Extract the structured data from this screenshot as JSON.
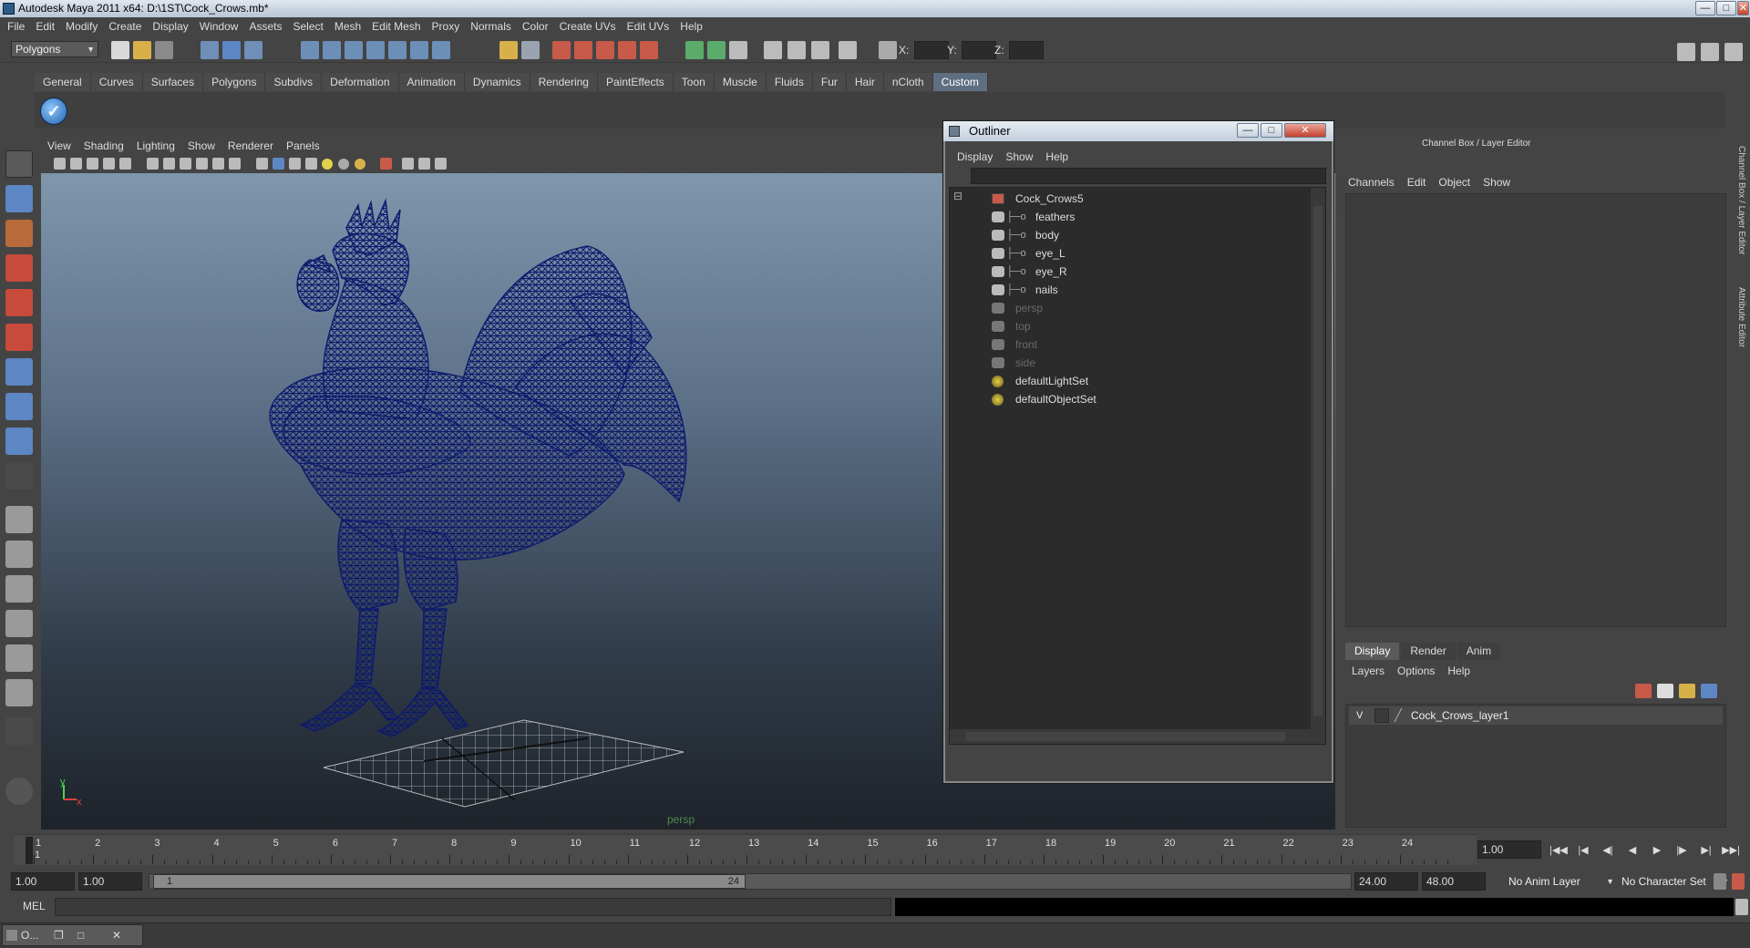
{
  "window": {
    "title": "Autodesk Maya 2011 x64: D:\\1ST\\Cock_Crows.mb*",
    "controls": [
      "—",
      "□",
      "✕"
    ]
  },
  "menubar": [
    "File",
    "Edit",
    "Modify",
    "Create",
    "Display",
    "Window",
    "Assets",
    "Select",
    "Mesh",
    "Edit Mesh",
    "Proxy",
    "Normals",
    "Color",
    "Create UVs",
    "Edit UVs",
    "Help"
  ],
  "statusline": {
    "mode": "Polygons",
    "x_label": "X:",
    "y_label": "Y:",
    "z_label": "Z:"
  },
  "shelf": {
    "tabs": [
      "General",
      "Curves",
      "Surfaces",
      "Polygons",
      "Subdivs",
      "Deformation",
      "Animation",
      "Dynamics",
      "Rendering",
      "PaintEffects",
      "Toon",
      "Muscle",
      "Fluids",
      "Fur",
      "Hair",
      "nCloth",
      "Custom"
    ],
    "active_tab": "Custom"
  },
  "viewport": {
    "menu": [
      "View",
      "Shading",
      "Lighting",
      "Show",
      "Renderer",
      "Panels"
    ],
    "camera_label": "persp",
    "axis_y": "y",
    "axis_x": "x",
    "wireframe_color": "#0d1a6e"
  },
  "outliner": {
    "title": "Outliner",
    "menu": [
      "Display",
      "Show",
      "Help"
    ],
    "items": [
      {
        "label": "Cock_Crows5",
        "kind": "group",
        "dim": false
      },
      {
        "label": "feathers",
        "kind": "mesh",
        "dim": false
      },
      {
        "label": "body",
        "kind": "mesh",
        "dim": false
      },
      {
        "label": "eye_L",
        "kind": "mesh",
        "dim": false
      },
      {
        "label": "eye_R",
        "kind": "mesh",
        "dim": false
      },
      {
        "label": "nails",
        "kind": "mesh",
        "dim": false
      },
      {
        "label": "persp",
        "kind": "camera",
        "dim": true
      },
      {
        "label": "top",
        "kind": "camera",
        "dim": true
      },
      {
        "label": "front",
        "kind": "camera",
        "dim": true
      },
      {
        "label": "side",
        "kind": "camera",
        "dim": true
      },
      {
        "label": "defaultLightSet",
        "kind": "set",
        "dim": false
      },
      {
        "label": "defaultObjectSet",
        "kind": "set",
        "dim": false
      }
    ]
  },
  "channelbox": {
    "title": "Channel Box / Layer Editor",
    "menu": [
      "Channels",
      "Edit",
      "Object",
      "Show"
    ],
    "layer_tabs": [
      "Display",
      "Render",
      "Anim"
    ],
    "active_layer_tab": "Display",
    "layer_menu": [
      "Layers",
      "Options",
      "Help"
    ],
    "layer": {
      "visible": "V",
      "name": "Cock_Crows_layer1"
    },
    "side_tabs": [
      "Channel Box / Layer Editor",
      "Attribute Editor"
    ]
  },
  "timeslider": {
    "ticks": [
      "1",
      "2",
      "3",
      "4",
      "5",
      "6",
      "7",
      "8",
      "9",
      "10",
      "11",
      "12",
      "13",
      "14",
      "15",
      "16",
      "17",
      "18",
      "19",
      "20",
      "21",
      "22",
      "23",
      "24"
    ],
    "current_frame_marker": "1",
    "current_time": "1.00"
  },
  "playback": {
    "buttons": [
      "|◀◀",
      "|◀",
      "◀|",
      "◀",
      "▶",
      "|▶",
      "▶|",
      "▶▶|"
    ]
  },
  "range": {
    "start": "1.00",
    "anim_start": "1.00",
    "slider_start": "1",
    "slider_end": "24",
    "anim_end": "24.00",
    "end": "48.00",
    "anim_layer": "No Anim Layer",
    "character_set": "No Character Set"
  },
  "commandline": {
    "label": "MEL"
  },
  "taskbar": {
    "item": "O..."
  }
}
